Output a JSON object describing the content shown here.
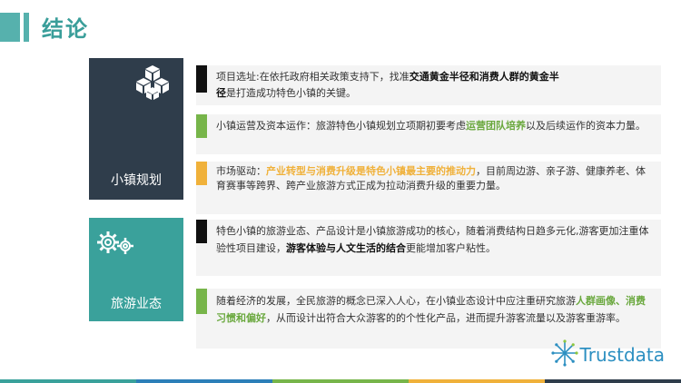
{
  "header": {
    "title": "结论"
  },
  "sections": [
    {
      "label": "小镇规划",
      "icon": "cubes-icon"
    },
    {
      "label": "旅游业态",
      "icon": "gears-icon"
    }
  ],
  "items": [
    {
      "t1": "项目选址:在依托政府相关政策支持下，找准",
      "b1": "交通黄金半径和消费人群的黄金半",
      "t2": "",
      "b2": "径",
      "t3": "是打造成功特色小镇的关键。"
    },
    {
      "t1": "小镇运营及资本运作：旅游特色小镇规划立项期初要考虑",
      "h1": "运营团队培养",
      "t2": "以及后续运作的资本力量。"
    },
    {
      "t1": "市场驱动：",
      "h1": "产业转型与消费升级是特色小镇最主要的推动力",
      "t2": "，目前周边游、亲子游、健康养老、体育赛事等跨界、跨产业旅游方式正成为拉动消费升级的重要力量。"
    },
    {
      "t1": "特色小镇的旅游业态、产品设计是小镇旅游成功的核心，随着消费结构日趋多元化,游客更加注重体验性项目建设，",
      "b1": "游客体验与人文生活的结合",
      "t2": "更能增加客户粘性。"
    },
    {
      "t1": "随着经济的发展，全民旅游的概念已深入人心，在小镇业态设计中应注重研究旅游",
      "h1": "人群画像、消费习惯和偏好",
      "t2": "，从而设计出符合大众游客的的个性化产品，进而提升游客流量以及游客重游率。"
    }
  ],
  "logo": {
    "text": "Trustdata",
    "icon": "trustdata-logo-icon"
  },
  "colors": {
    "teal": "#3aa19b",
    "dark": "#2f3d4b",
    "green": "#77b54a",
    "yellow": "#f0b13a",
    "blue": "#2c8fc1"
  }
}
